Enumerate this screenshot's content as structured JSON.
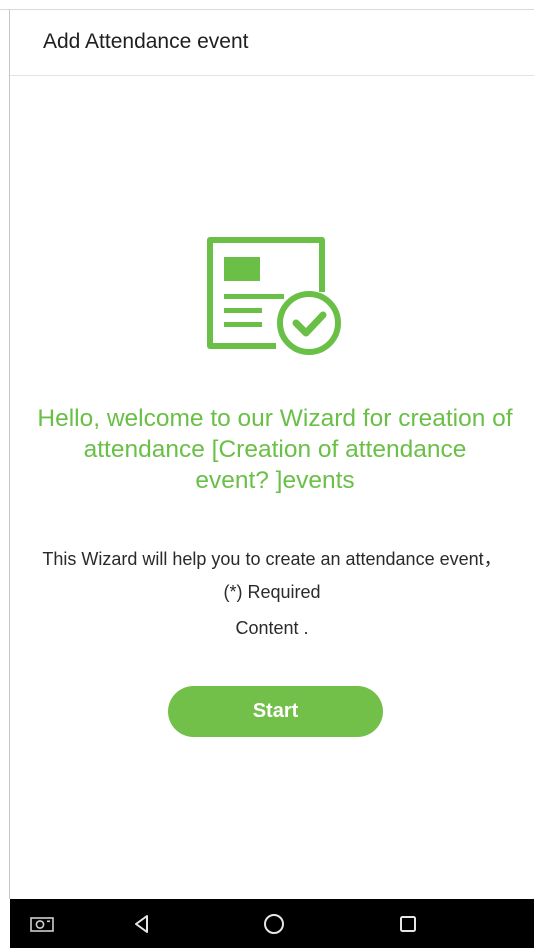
{
  "header": {
    "title": "Add Attendance event"
  },
  "illustration": {
    "icon": "attendance-card-check-icon",
    "color": "#6abf47"
  },
  "welcome": {
    "line1": "Hello, welcome to our Wizard for creation of",
    "line2": "attendance [Creation of attendance",
    "line3": "event? ]events"
  },
  "description": {
    "line1": "This Wizard will help you to create an attendance event，",
    "line2": "(*)  Required",
    "line3": "Content ."
  },
  "actions": {
    "start_label": "Start",
    "accent": "#72c04a"
  },
  "system_nav": {
    "items": [
      "camera-icon",
      "back-icon",
      "home-icon",
      "recents-icon"
    ]
  }
}
